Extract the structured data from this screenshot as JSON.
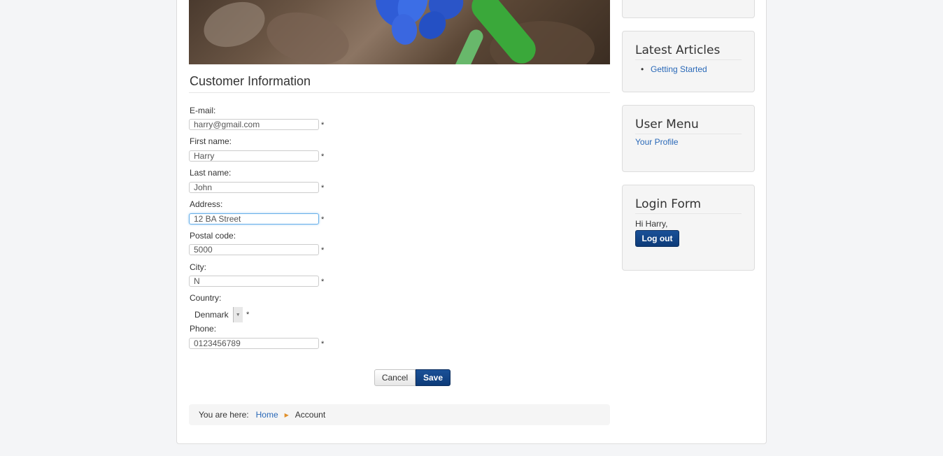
{
  "form": {
    "title": "Customer Information",
    "required_marker": "*",
    "fields": {
      "email": {
        "label": "E-mail:",
        "value": "harry@gmail.com"
      },
      "first_name": {
        "label": "First name:",
        "value": "Harry"
      },
      "last_name": {
        "label": "Last name:",
        "value": "John"
      },
      "address": {
        "label": "Address:",
        "value": "12 BA Street"
      },
      "postal_code": {
        "label": "Postal code:",
        "value": "5000"
      },
      "city": {
        "label": "City:",
        "value": "N"
      },
      "country": {
        "label": "Country:",
        "value": "Denmark"
      },
      "phone": {
        "label": "Phone:",
        "value": "0123456789"
      }
    },
    "buttons": {
      "cancel": "Cancel",
      "save": "Save"
    }
  },
  "breadcrumb": {
    "prefix": "You are here:",
    "items": [
      "Home",
      "Account"
    ]
  },
  "sidebar": {
    "latest_articles": {
      "title": "Latest Articles",
      "items": [
        "Getting Started"
      ]
    },
    "user_menu": {
      "title": "User Menu",
      "items": [
        "Your Profile"
      ]
    },
    "login_form": {
      "title": "Login Form",
      "greeting": "Hi Harry,",
      "logout_label": "Log out"
    }
  },
  "colors": {
    "accent_button": "#0d3b78",
    "link": "#2a69b8",
    "breadcrumb_arrow": "#e08f2a",
    "focus_border": "#66afe9"
  },
  "icons": {
    "select_arrow": "chevron-down-icon",
    "breadcrumb_separator": "triangle-right-icon"
  }
}
